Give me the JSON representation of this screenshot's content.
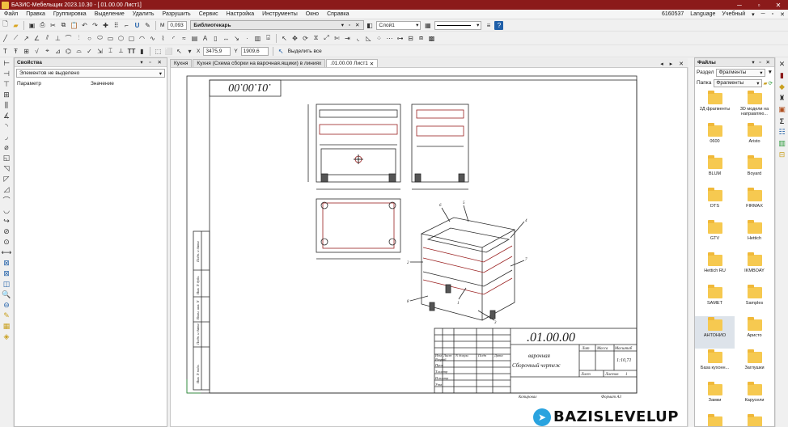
{
  "window": {
    "title": "БАЗИС-Мебельщик 2023.10.30 - [.01.00.00 Лист1]"
  },
  "menu": {
    "items": [
      "Файл",
      "Правка",
      "Группировка",
      "Выделение",
      "Удалить",
      "Разрушить",
      "Сервис",
      "Настройка",
      "Инструменты",
      "Окно",
      "Справка"
    ],
    "right": {
      "id": "6160537",
      "language": "Language",
      "mode": "Учебный"
    }
  },
  "toolbar": {
    "scale_label": "M",
    "scale_value": "0,093",
    "library_title": "Библиотекарь",
    "layer": "Слой1",
    "coord_x_label": "X",
    "coord_x": "3475,9",
    "coord_y_label": "Y",
    "coord_y": "1909,6",
    "select_all": "Выделить все"
  },
  "properties": {
    "title": "Свойства",
    "selection": "Элементов не выделено",
    "col_param": "Параметр",
    "col_value": "Значение"
  },
  "tabs": [
    {
      "label": "Кухня",
      "active": false
    },
    {
      "label": "Кухня (Схема сборки на варочная.ящики) в линиях",
      "active": false
    },
    {
      "label": ".01.00.00 Лист1",
      "active": true
    }
  ],
  "drawing": {
    "stamp_top": ".01.00.00",
    "doc_code": ".01.00.00",
    "name_line1": "варочная",
    "name_line2": "Сборочный чертеж",
    "scale_value": "1:10,71",
    "col_lit": "Лит",
    "col_mass": "Масса",
    "col_scale": "Масштаб",
    "sheet": "Лист",
    "sheets": "Листов",
    "sheets_count": "1",
    "rows_left": [
      "Изм",
      "Лист",
      "N докум.",
      "Подп",
      "Дата"
    ],
    "roles": [
      "Разраб",
      "Пров",
      "Т.контр",
      "Н.контр",
      "Утв"
    ],
    "copied": "Копировал",
    "format": "Формат А3",
    "side_labels": [
      "Подп. и дата",
      "Инв. N дубл.",
      "Взам. инв. N",
      "Подп. и дата",
      "Инв. N подл."
    ],
    "callouts": [
      "6",
      "5",
      "4",
      "2",
      "7",
      "8",
      "1",
      "3"
    ]
  },
  "files": {
    "title": "Файлы",
    "section_label": "Раздел",
    "section_value": "Фрагменты",
    "folder_label": "Папка",
    "folder_value": "Фрагменты",
    "items": [
      {
        "name": "2Д фрагменты",
        "highlight": false
      },
      {
        "name": "3D модели на направляю...",
        "highlight": false
      },
      {
        "name": "0600",
        "highlight": false
      },
      {
        "name": "Aristo",
        "highlight": false
      },
      {
        "name": "BLUM",
        "highlight": false
      },
      {
        "name": "Boyard",
        "highlight": false
      },
      {
        "name": "DTS",
        "highlight": false
      },
      {
        "name": "FIRMAX",
        "highlight": false
      },
      {
        "name": "GTV",
        "highlight": false
      },
      {
        "name": "Hettich",
        "highlight": false
      },
      {
        "name": "Hettich RU",
        "highlight": false
      },
      {
        "name": "IKMBOAY",
        "highlight": false
      },
      {
        "name": "SAMET",
        "highlight": false
      },
      {
        "name": "Samples",
        "highlight": false
      },
      {
        "name": "АНТОНИО",
        "highlight": true
      },
      {
        "name": "Аристо",
        "highlight": false
      },
      {
        "name": "База кухонн...",
        "highlight": false
      },
      {
        "name": "Заглушки",
        "highlight": false
      },
      {
        "name": "Замки",
        "highlight": false
      },
      {
        "name": "Карусели",
        "highlight": false
      },
      {
        "name": "",
        "highlight": false
      },
      {
        "name": "",
        "highlight": false
      }
    ]
  },
  "watermark": {
    "text": "BAZISLEVELUP"
  },
  "colors": {
    "titlebar": "#8b1a1a",
    "accent": "#1f5fa8",
    "folder": "#f6c950",
    "drawing_line": "#2a2a2a",
    "drawing_red": "#9a2020"
  }
}
